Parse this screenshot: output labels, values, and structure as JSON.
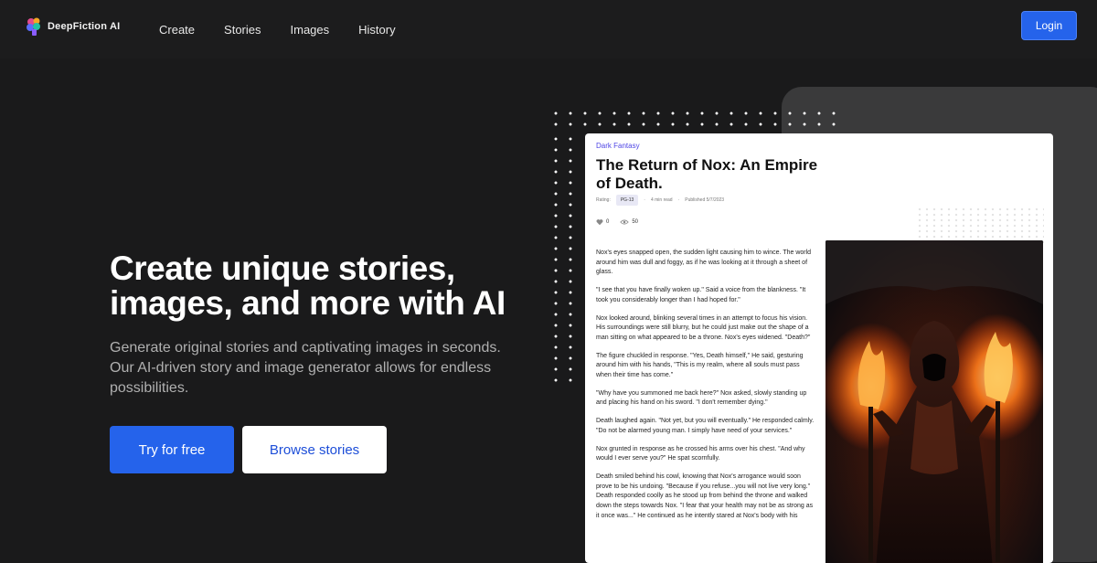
{
  "nav": {
    "logo_text": "DeepFiction AI",
    "links": [
      "Create",
      "Stories",
      "Images",
      "History"
    ],
    "login_label": "Login"
  },
  "hero": {
    "title": "Create unique stories, images, and more with AI",
    "subtitle": "Generate original stories and captivating images in seconds. Our AI-driven story and image generator allows for endless possibilities.",
    "primary_cta": "Try for free",
    "secondary_cta": "Browse stories"
  },
  "story_card": {
    "genre": "Dark Fantasy",
    "title": "The Return of Nox: An Empire of Death.",
    "rating_label": "Rating:",
    "rating": "PG-13",
    "read_time": "4 min read",
    "published": "Published 5/7/2023",
    "likes": "0",
    "views": "50",
    "paragraphs": [
      "Nox's eyes snapped open, the sudden light causing him to wince. The world around him was dull and foggy, as if he was looking at it through a sheet of glass.",
      "\"I see that you have finally woken up.\" Said a voice from the blankness. \"It took you considerably longer than I had hoped for.\"",
      "Nox looked around, blinking several times in an attempt to focus his vision. His surroundings were still blurry, but he could just make out the shape of a man sitting on what appeared to be a throne. Nox's eyes widened. \"Death?\"",
      "The figure chuckled in response. \"Yes, Death himself,\" He said, gesturing around him with his hands, \"This is my realm, where all souls must pass when their time has come.\"",
      "\"Why have you summoned me back here?\" Nox asked, slowly standing up and placing his hand on his sword. \"I don't remember dying.\"",
      "Death laughed again. \"Not yet, but you will eventually.\" He responded calmly. \"Do not be alarmed young man. I simply have need of your services.\"",
      "Nox grunted in response as he crossed his arms over his chest. \"And why would I ever serve you?\" He spat scornfully.",
      "Death smiled behind his cowl, knowing that Nox's arrogance would soon prove to be his undoing. \"Because if you refuse...you will not live very long.\" Death responded coolly as he stood up from behind the throne and walked down the steps towards Nox. \"I fear that your health may not be as strong as it once was...\" He continued as he intently stared at Nox's body with his"
    ]
  },
  "colors": {
    "background": "#1a1a1b",
    "accent": "#2563eb",
    "genre": "#4f46e5"
  }
}
